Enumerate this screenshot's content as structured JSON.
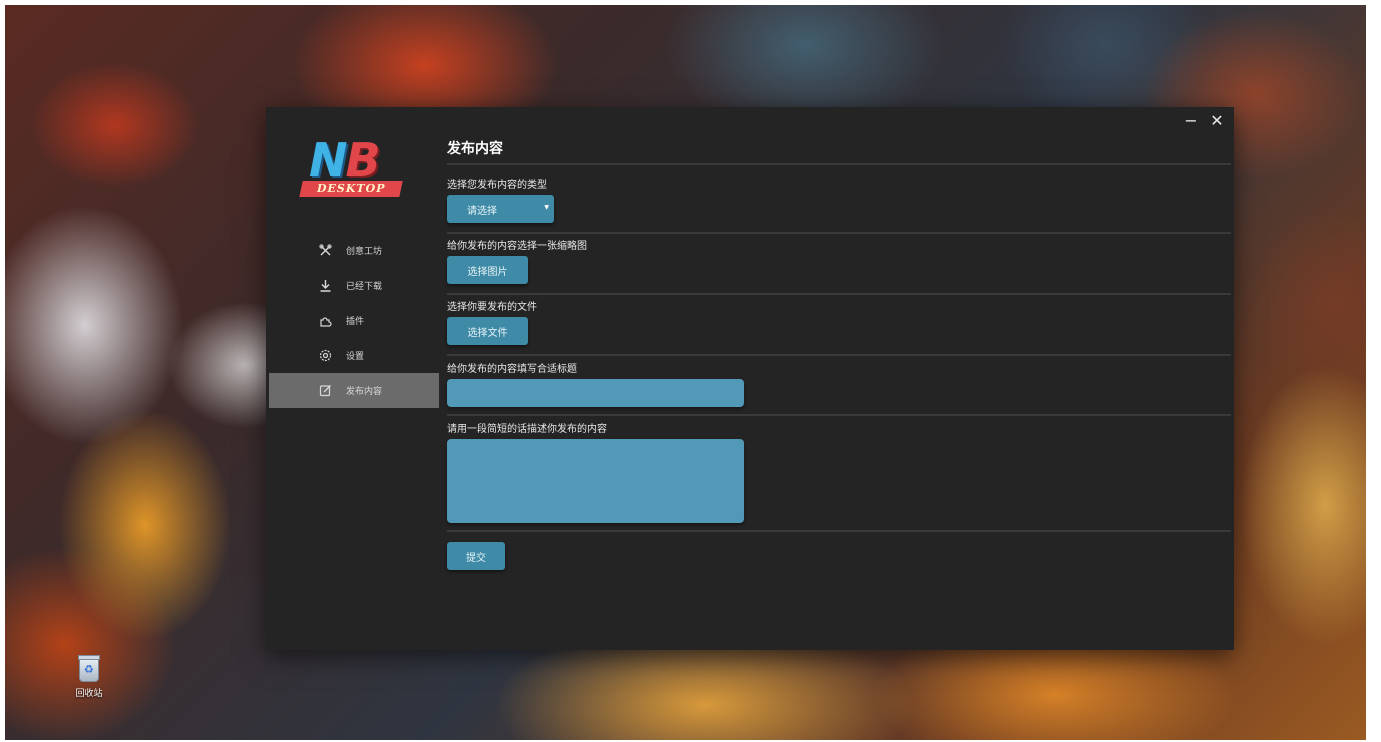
{
  "desktop": {
    "recycle_bin_label": "回收站"
  },
  "window": {
    "minimize_glyph": "−",
    "close_glyph": "✕"
  },
  "logo": {
    "nb_n": "N",
    "nb_b": "B",
    "desktop_text": "DESKTOP"
  },
  "sidebar": {
    "items": [
      {
        "label": "创意工坊",
        "icon": "workshop-icon"
      },
      {
        "label": "已经下载",
        "icon": "download-icon"
      },
      {
        "label": "插件",
        "icon": "plugin-icon"
      },
      {
        "label": "设置",
        "icon": "gear-icon"
      },
      {
        "label": "发布内容",
        "icon": "edit-icon",
        "active": true
      }
    ]
  },
  "main": {
    "title": "发布内容",
    "type_label": "选择您发布内容的类型",
    "type_select_value": "请选择",
    "thumb_label": "给你发布的内容选择一张缩略图",
    "thumb_button": "选择图片",
    "file_label": "选择你要发布的文件",
    "file_button": "选择文件",
    "name_label": "给你发布的内容填写合适标题",
    "name_value": "",
    "desc_label": "请用一段简短的话描述你发布的内容",
    "desc_value": "",
    "submit_button": "提交"
  },
  "colors": {
    "window_bg": "#242424",
    "accent": "#3f8aa6",
    "input_bg": "#5199b6",
    "active_nav": "#6b6b6b"
  }
}
